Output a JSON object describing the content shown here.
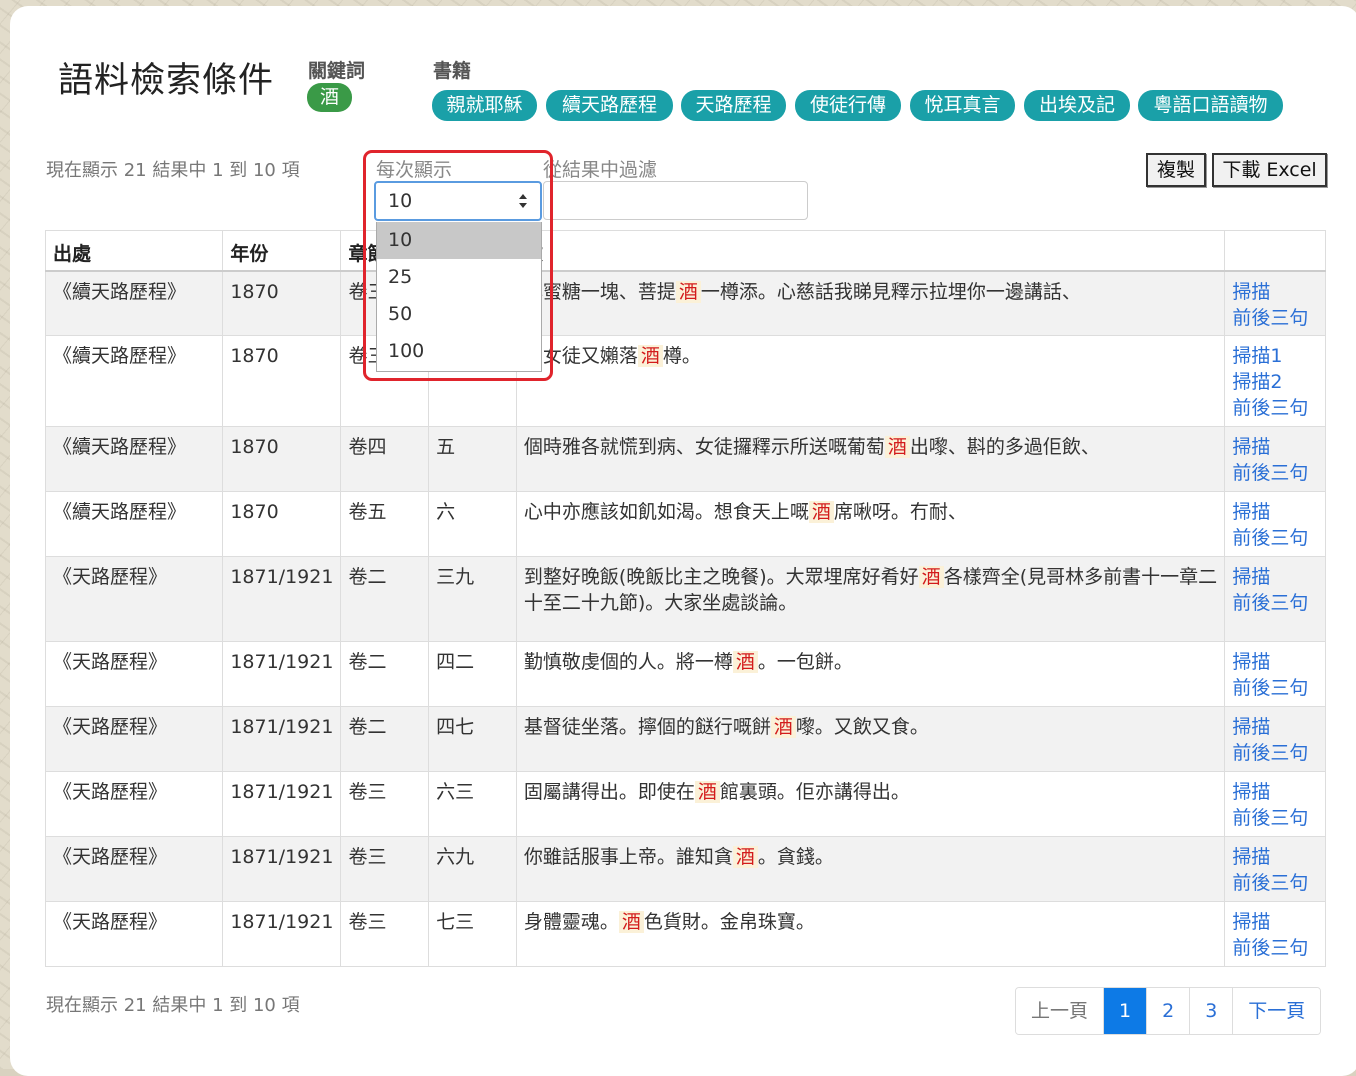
{
  "header": {
    "title": "語料檢索條件",
    "keyword_label": "關鍵詞",
    "keyword": "酒",
    "books_label": "書籍",
    "books": [
      "親就耶穌",
      "續天路歷程",
      "天路歷程",
      "使徒行傳",
      "悅耳真言",
      "出埃及記",
      "粵語口語讀物"
    ]
  },
  "controls": {
    "info_top": "現在顯示 21 結果中 1 到 10 項",
    "per_page_label": "每次顯示",
    "per_page_value": "10",
    "per_page_options": [
      "10",
      "25",
      "50",
      "100"
    ],
    "filter_label": "從結果中過濾",
    "filter_value": "",
    "copy_label": "複製",
    "excel_label": "下載 Excel"
  },
  "table": {
    "headers": [
      "出處",
      "年份",
      "章節",
      "",
      "文",
      ""
    ],
    "rows": [
      {
        "source": "《續天路歷程》",
        "year": "1870",
        "vol": "卷三",
        "ch": "",
        "pre": "俾蜜糖一塊、菩提",
        "kw": "酒",
        "post": "一樽添。心慈話我睇見釋示拉埋你一邊講話、",
        "links": [
          "掃描",
          "前後三句"
        ]
      },
      {
        "source": "《續天路歷程》",
        "year": "1870",
        "vol": "卷三",
        "ch": "",
        "pre": "今女徒又嬾落",
        "kw": "酒",
        "post": "樽。",
        "links": [
          "掃描1",
          "掃描2",
          "前後三句"
        ]
      },
      {
        "source": "《續天路歷程》",
        "year": "1870",
        "vol": "卷四",
        "ch": "五",
        "pre": "個時雅各就慌到病、女徒攞釋示所送嘅葡萄",
        "kw": "酒",
        "post": "出嚟、斟的多過佢飲、",
        "links": [
          "掃描",
          "前後三句"
        ]
      },
      {
        "source": "《續天路歷程》",
        "year": "1870",
        "vol": "卷五",
        "ch": "六",
        "pre": "心中亦應該如飢如渴。想食天上嘅",
        "kw": "酒",
        "post": "席啾呀。冇耐、",
        "links": [
          "掃描",
          "前後三句"
        ]
      },
      {
        "source": "《天路歷程》",
        "year": "1871/1921",
        "vol": "卷二",
        "ch": "三九",
        "pre": "到整好晚飯(晚飯比主之晚餐)。大眾埋席好肴好",
        "kw": "酒",
        "post": "各樣齊全(見哥林多前書十一章二十至二十九節)。大家坐處談論。",
        "links": [
          "掃描",
          "前後三句"
        ]
      },
      {
        "source": "《天路歷程》",
        "year": "1871/1921",
        "vol": "卷二",
        "ch": "四二",
        "pre": "勤慎敬虔個的人。將一樽",
        "kw": "酒",
        "post": "。一包餅。",
        "links": [
          "掃描",
          "前後三句"
        ]
      },
      {
        "source": "《天路歷程》",
        "year": "1871/1921",
        "vol": "卷二",
        "ch": "四七",
        "pre": "基督徒坐落。擰個的餸行嘅餅",
        "kw": "酒",
        "post": "嚟。又飲又食。",
        "links": [
          "掃描",
          "前後三句"
        ]
      },
      {
        "source": "《天路歷程》",
        "year": "1871/1921",
        "vol": "卷三",
        "ch": "六三",
        "pre": "固屬講得出。即使在",
        "kw": "酒",
        "post": "館裏頭。佢亦講得出。",
        "links": [
          "掃描",
          "前後三句"
        ]
      },
      {
        "source": "《天路歷程》",
        "year": "1871/1921",
        "vol": "卷三",
        "ch": "六九",
        "pre": "你雖話服事上帝。誰知貪",
        "kw": "酒",
        "post": "。貪錢。",
        "links": [
          "掃描",
          "前後三句"
        ]
      },
      {
        "source": "《天路歷程》",
        "year": "1871/1921",
        "vol": "卷三",
        "ch": "七三",
        "pre": "身體靈魂。",
        "kw": "酒",
        "post": "色貨財。金帛珠寶。",
        "links": [
          "掃描",
          "前後三句"
        ]
      }
    ]
  },
  "footer": {
    "info_bottom": "現在顯示 21 結果中 1 到 10 項",
    "prev": "上一頁",
    "pages": [
      "1",
      "2",
      "3"
    ],
    "active_page": "1",
    "next": "下一頁"
  },
  "colors": {
    "keyword_badge": "#3a9a47",
    "book_chip": "#1aa0a8",
    "keyword_highlight": "#d31b1b",
    "link": "#2a6fd6",
    "active_page": "#0d7ae6",
    "annotation_ring": "#e0242c"
  }
}
